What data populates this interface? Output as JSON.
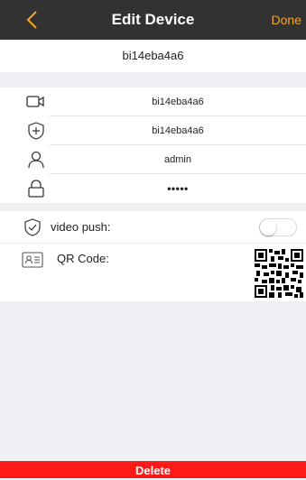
{
  "nav": {
    "title": "Edit Device",
    "done_label": "Done",
    "back_icon": "chevron-left-icon",
    "accent_color": "#f5a623",
    "bar_color": "#323232"
  },
  "device_header": {
    "name": "bi14eba4a6"
  },
  "fields": [
    {
      "icon": "camera-icon",
      "value": "bi14eba4a6"
    },
    {
      "icon": "shield-plus-icon",
      "value": "bi14eba4a6"
    },
    {
      "icon": "user-icon",
      "value": "admin"
    },
    {
      "icon": "lock-icon",
      "value": "•••••"
    }
  ],
  "video_push": {
    "icon": "shield-check-icon",
    "label": "video push:",
    "enabled": false
  },
  "qr_code": {
    "icon": "id-card-icon",
    "label": "QR Code:",
    "image_icon": "qr-code-icon"
  },
  "delete_button": {
    "label": "Delete",
    "color": "#ff1a1a"
  }
}
